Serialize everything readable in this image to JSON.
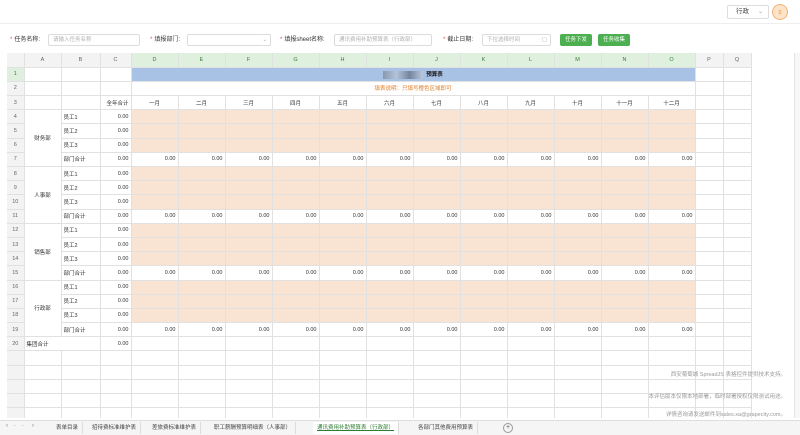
{
  "header": {
    "dept_value": "行政",
    "avatar_glyph": "♀"
  },
  "form": {
    "task_label": "任务名称:",
    "task_placeholder": "请输入任务名称",
    "dept_label": "填报部门:",
    "sheet_label": "填报sheet名称:",
    "sheet_placeholder": "通讯费用补助预算表（行政部）",
    "deadline_label": "截止日期:",
    "deadline_placeholder": "下拉选择时间",
    "btn_assign": "任务下发",
    "btn_collect": "任务收集"
  },
  "sheet": {
    "columns": [
      "A",
      "B",
      "C",
      "D",
      "E",
      "F",
      "G",
      "H",
      "I",
      "J",
      "K",
      "L",
      "M",
      "N",
      "O",
      "P",
      "Q"
    ],
    "title": "预算表",
    "note": "填表说明：只填写橙色区域即可",
    "total_header": "全年合计",
    "months": [
      "一月",
      "二月",
      "三月",
      "四月",
      "五月",
      "六月",
      "七月",
      "八月",
      "九月",
      "十月",
      "十一月",
      "十二月"
    ],
    "employees": [
      "员工1",
      "员工2",
      "员工3"
    ],
    "dept_total_label": "部门合计",
    "departments": [
      "财务部",
      "人事部",
      "销售部",
      "行政部"
    ],
    "group_total_label": "集团合计",
    "zero": "0.00"
  },
  "watermark": {
    "line1": "西安葡萄城 SpreadJS 表格控件提供技术支持。",
    "line2": "本评估版本仅限本地部署，临时部署授权仅限测试用途。",
    "line3": "详情咨询请发送邮件到sales.xa@grapecity.com。"
  },
  "tabs": [
    "表单目录",
    "招待费标准维护表",
    "差旅费标准维护表",
    "职工薪酬预算明细表（人事部）",
    "通讯费用补助预算表（行政部）",
    "各部门其他费用预算表"
  ],
  "active_tab": 4
}
